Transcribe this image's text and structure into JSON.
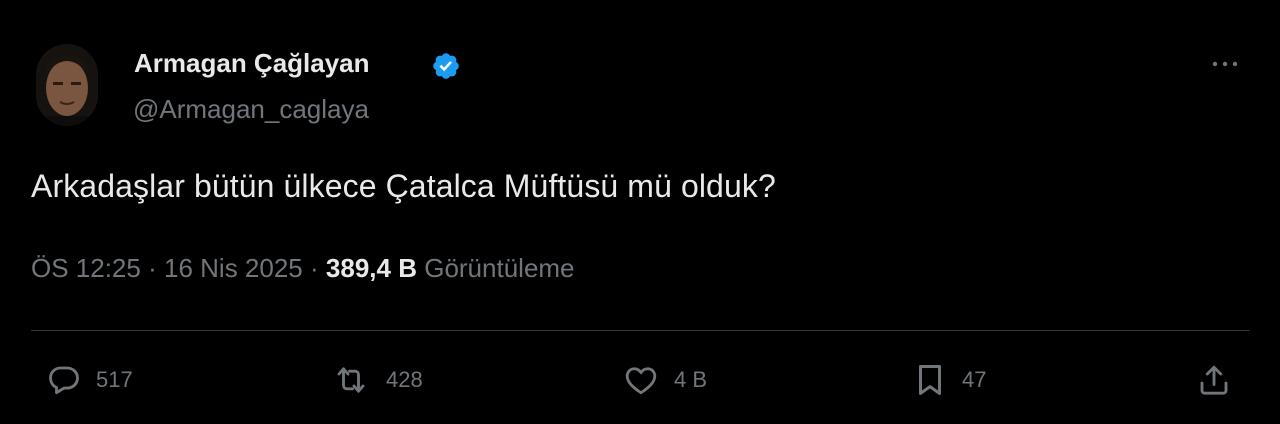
{
  "tweet": {
    "author": {
      "display_name": "Armagan Çağlayan",
      "handle": "@Armagan_caglaya",
      "verified": true,
      "verified_color": "#1d9bf0"
    },
    "text": "Arkadaşlar bütün ülkece Çatalca Müftüsü mü olduk?",
    "time": "ÖS 12:25",
    "date": "16 Nis 2025",
    "separator": "·",
    "views_count": "389,4 B",
    "views_label": "Görüntüleme"
  },
  "actions": {
    "replies": "517",
    "retweets": "428",
    "likes": "4 B",
    "bookmarks": "47"
  },
  "icons": [
    "more-icon",
    "reply-icon",
    "retweet-icon",
    "like-icon",
    "bookmark-icon",
    "share-icon",
    "verified-badge-icon"
  ],
  "colors": {
    "background": "#000000",
    "text_primary": "#e7e9ea",
    "text_secondary": "#71767b",
    "divider": "#2f3336"
  }
}
